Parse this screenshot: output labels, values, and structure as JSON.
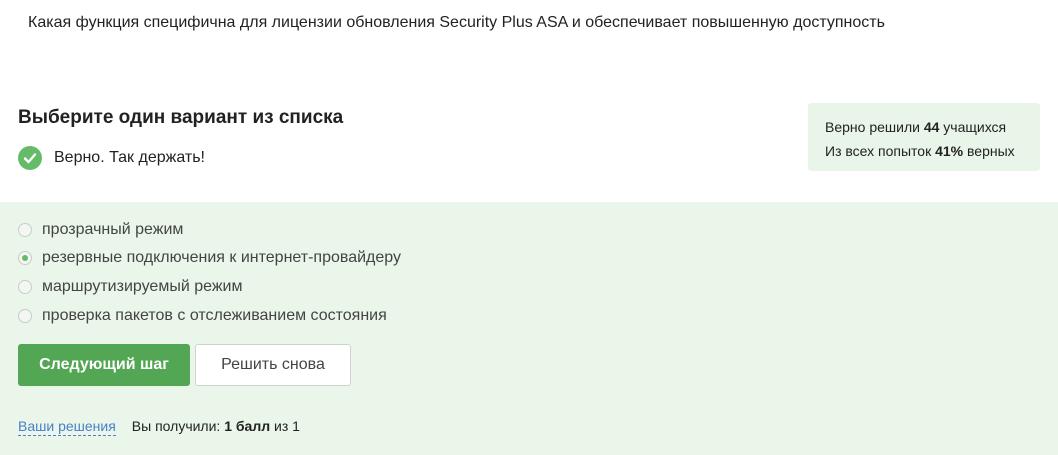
{
  "question": {
    "text": "Какая функция специфична для лицензии обновления Security Plus ASA и обеспечивает повышенную доступность"
  },
  "task": {
    "title": "Выберите один вариант из списка",
    "feedback_text": "Верно. Так держать!",
    "feedback_icon": "check-circle-icon",
    "accent_color": "#66bb6a"
  },
  "stats": {
    "line1_prefix": "Верно решили",
    "line1_count": "44",
    "line1_suffix": "учащихся",
    "line2_prefix": "Из всех попыток",
    "line2_percent": "41%",
    "line2_suffix": "верных"
  },
  "options": [
    {
      "label": "прозрачный режим",
      "selected": false
    },
    {
      "label": "резервные подключения к интернет-провайдеру",
      "selected": true
    },
    {
      "label": "маршрутизируемый режим",
      "selected": false
    },
    {
      "label": "проверка пакетов с отслеживанием состояния",
      "selected": false
    }
  ],
  "buttons": {
    "next_label": "Следующий шаг",
    "retry_label": "Решить снова"
  },
  "footer": {
    "solutions_link": "Ваши решения",
    "score_prefix": "Вы получили:",
    "score_value": "1 балл",
    "score_suffix": "из 1"
  }
}
